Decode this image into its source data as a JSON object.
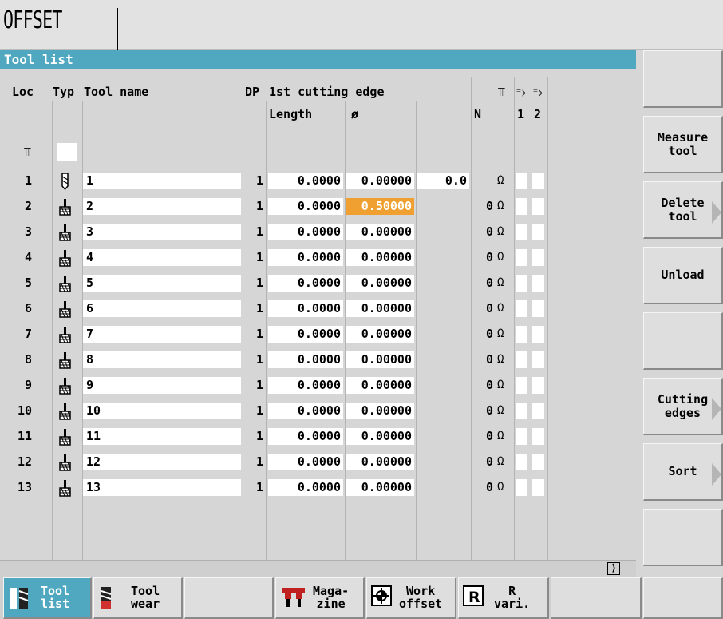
{
  "header": {
    "title": "OFFSET"
  },
  "panel": {
    "title": "Tool list"
  },
  "columns": {
    "loc": "Loc",
    "typ": "Typ",
    "name": "Tool name",
    "dp": "DP",
    "edge": "1st cutting edge",
    "length": "Length",
    "diameter": "ø",
    "n": "N",
    "magazine_icon": "⫪",
    "sub1_icon": "⥱",
    "sub2_icon": "⥱",
    "sub1": "1",
    "sub2": "2",
    "loc_icon": "⫪"
  },
  "rows": [
    {
      "loc": "1",
      "type": "drill-icon",
      "name": "1",
      "dp": "1",
      "length": "0.0000",
      "diameter": "0.00000",
      "col4": "0.0",
      "n": "",
      "status": "Ω"
    },
    {
      "loc": "2",
      "type": "mill-icon",
      "name": "2",
      "dp": "1",
      "length": "0.0000",
      "diameter": "0.50000",
      "col4": "",
      "n": "0",
      "status": "Ω"
    },
    {
      "loc": "3",
      "type": "mill-icon",
      "name": "3",
      "dp": "1",
      "length": "0.0000",
      "diameter": "0.00000",
      "col4": "",
      "n": "0",
      "status": "Ω"
    },
    {
      "loc": "4",
      "type": "mill-icon",
      "name": "4",
      "dp": "1",
      "length": "0.0000",
      "diameter": "0.00000",
      "col4": "",
      "n": "0",
      "status": "Ω"
    },
    {
      "loc": "5",
      "type": "mill-icon",
      "name": "5",
      "dp": "1",
      "length": "0.0000",
      "diameter": "0.00000",
      "col4": "",
      "n": "0",
      "status": "Ω"
    },
    {
      "loc": "6",
      "type": "mill-icon",
      "name": "6",
      "dp": "1",
      "length": "0.0000",
      "diameter": "0.00000",
      "col4": "",
      "n": "0",
      "status": "Ω"
    },
    {
      "loc": "7",
      "type": "mill-icon",
      "name": "7",
      "dp": "1",
      "length": "0.0000",
      "diameter": "0.00000",
      "col4": "",
      "n": "0",
      "status": "Ω"
    },
    {
      "loc": "8",
      "type": "mill-icon",
      "name": "8",
      "dp": "1",
      "length": "0.0000",
      "diameter": "0.00000",
      "col4": "",
      "n": "0",
      "status": "Ω"
    },
    {
      "loc": "9",
      "type": "mill-icon",
      "name": "9",
      "dp": "1",
      "length": "0.0000",
      "diameter": "0.00000",
      "col4": "",
      "n": "0",
      "status": "Ω"
    },
    {
      "loc": "10",
      "type": "mill-icon",
      "name": "10",
      "dp": "1",
      "length": "0.0000",
      "diameter": "0.00000",
      "col4": "",
      "n": "0",
      "status": "Ω"
    },
    {
      "loc": "11",
      "type": "mill-icon",
      "name": "11",
      "dp": "1",
      "length": "0.0000",
      "diameter": "0.00000",
      "col4": "",
      "n": "0",
      "status": "Ω"
    },
    {
      "loc": "12",
      "type": "mill-icon",
      "name": "12",
      "dp": "1",
      "length": "0.0000",
      "diameter": "0.00000",
      "col4": "",
      "n": "0",
      "status": "Ω"
    },
    {
      "loc": "13",
      "type": "mill-icon",
      "name": "13",
      "dp": "1",
      "length": "0.0000",
      "diameter": "0.00000",
      "col4": "",
      "n": "0",
      "status": "Ω"
    }
  ],
  "selected_cell": {
    "row": 2,
    "column": "diameter"
  },
  "scroll": {
    "right_icon": "⟩"
  },
  "softkeys_right": [
    {
      "label": "",
      "arrow": false
    },
    {
      "label": "Measure\ntool",
      "arrow": false
    },
    {
      "label": "Delete\ntool",
      "arrow": true
    },
    {
      "label": "Unload",
      "arrow": false
    },
    {
      "label": "",
      "arrow": false
    },
    {
      "label": "Cutting\nedges",
      "arrow": true
    },
    {
      "label": "Sort",
      "arrow": true
    },
    {
      "label": "",
      "arrow": false
    }
  ],
  "softkeys_bottom": [
    {
      "label": "Tool\nlist",
      "icon": "tool-list-icon",
      "active": true
    },
    {
      "label": "Tool\nwear",
      "icon": "tool-wear-icon",
      "active": false
    },
    {
      "label": "",
      "icon": "",
      "active": false
    },
    {
      "label": "Maga-\nzine",
      "icon": "magazine-icon",
      "active": false
    },
    {
      "label": "Work\noffset",
      "icon": "work-offset-icon",
      "active": false
    },
    {
      "label": "R\nvari.",
      "icon": "r-variables-icon",
      "active": false
    },
    {
      "label": "",
      "icon": "",
      "active": false
    },
    {
      "label": "",
      "icon": "",
      "active": false
    }
  ],
  "colors": {
    "accent": "#4fa8c0",
    "selection": "#f0a030",
    "background": "#d6d6d6"
  }
}
